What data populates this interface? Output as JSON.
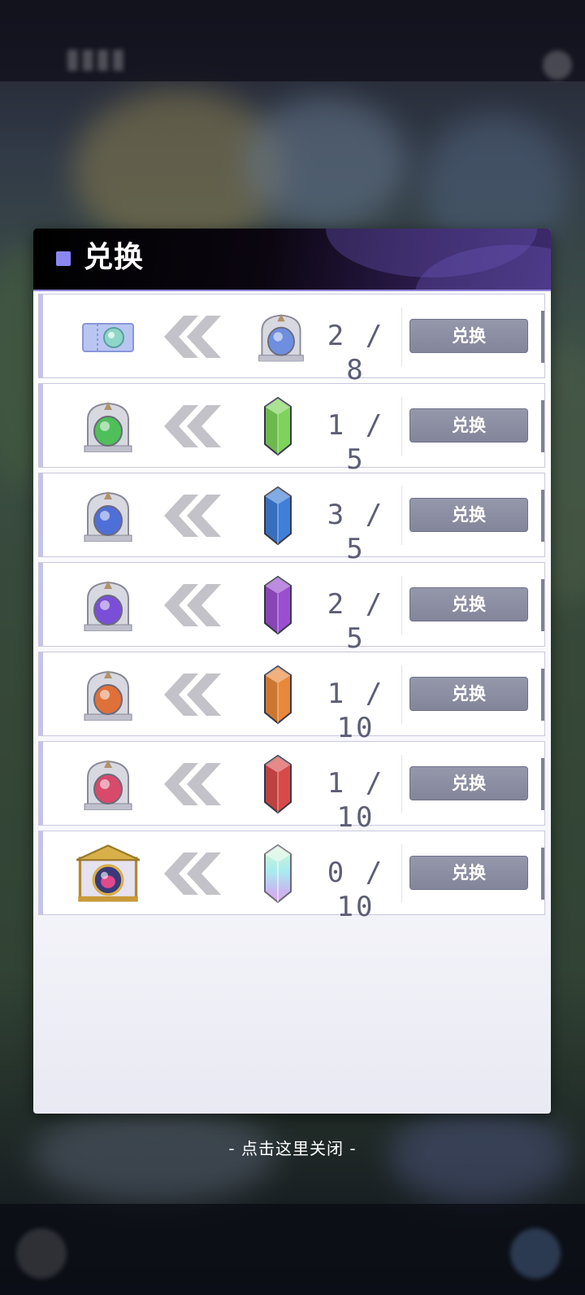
{
  "dialog": {
    "title": "兑换",
    "accent_color": "#8b86f2",
    "close_hint": "- 点击这里关闭 -"
  },
  "rows": [
    {
      "target_icon": "ticket-icon",
      "cost_icon": "silver-portal-icon",
      "count": "2 / 8",
      "button_label": "兑换"
    },
    {
      "target_icon": "green-portal-icon",
      "cost_icon": "green-crystal-icon",
      "count": "1 / 5",
      "button_label": "兑换"
    },
    {
      "target_icon": "blue-portal-icon",
      "cost_icon": "blue-crystal-icon",
      "count": "3 / 5",
      "button_label": "兑换"
    },
    {
      "target_icon": "purple-portal-icon",
      "cost_icon": "purple-crystal-icon",
      "count": "2 / 5",
      "button_label": "兑换"
    },
    {
      "target_icon": "orange-portal-icon",
      "cost_icon": "orange-crystal-icon",
      "count": "1 / 10",
      "button_label": "兑换"
    },
    {
      "target_icon": "red-portal-icon",
      "cost_icon": "red-crystal-icon",
      "count": "1 / 10",
      "button_label": "兑换"
    },
    {
      "target_icon": "golden-gate-icon",
      "cost_icon": "rainbow-crystal-icon",
      "count": "0 / 10",
      "button_label": "兑换"
    }
  ]
}
